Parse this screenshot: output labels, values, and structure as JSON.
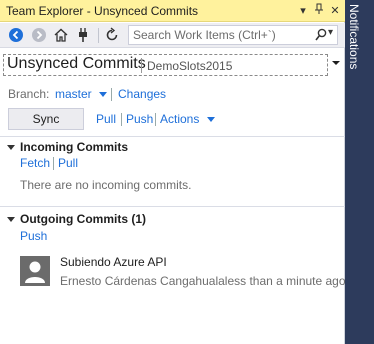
{
  "window": {
    "title": "Team Explorer - Unsynced Commits",
    "dropdown_glyph": "▾",
    "pin_glyph": "⊥",
    "close_glyph": "✕"
  },
  "toolbar": {
    "search_placeholder": "Search Work Items (Ctrl+`)",
    "search_dropdown_glyph": "▾",
    "icons": [
      "back-icon",
      "forward-icon",
      "home-icon",
      "connect-icon",
      "refresh-icon",
      "search-icon"
    ]
  },
  "page": {
    "title": "Unsynced Commits",
    "subtitle": "DemoSlots2015"
  },
  "branch": {
    "label": "Branch:",
    "value": "master",
    "changes_link": "Changes"
  },
  "actions": {
    "sync": "Sync",
    "pull": "Pull",
    "push": "Push",
    "more": "Actions"
  },
  "incoming": {
    "header": "Incoming Commits",
    "fetch": "Fetch",
    "pull": "Pull",
    "empty_text": "There are no incoming commits."
  },
  "outgoing": {
    "header": "Outgoing Commits (1)",
    "push": "Push",
    "commits": [
      {
        "message": "Subiendo Azure API",
        "author": "Ernesto Cárdenas Cangahuala",
        "time": "less than a minute ago"
      }
    ]
  },
  "side_panel": {
    "label": "Notifications"
  },
  "colors": {
    "title_bar": "#fff29d",
    "link": "#1e6fd9",
    "notifications_strip": "#2d3b5c"
  }
}
